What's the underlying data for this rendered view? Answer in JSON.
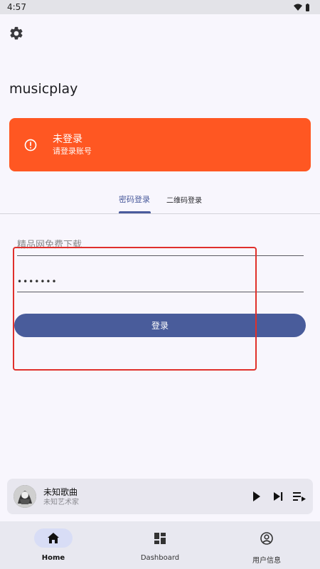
{
  "status_bar": {
    "time": "4:57",
    "icons": [
      "wifi-icon",
      "battery-icon"
    ]
  },
  "header": {
    "settings_icon": "gear-icon"
  },
  "app": {
    "title": "musicplay"
  },
  "banner": {
    "icon": "alert-circle-icon",
    "title": "未登录",
    "subtitle": "请登录账号",
    "color": "#ff5722"
  },
  "tabs": [
    {
      "label": "密码登录",
      "active": true
    },
    {
      "label": "二维码登录",
      "active": false
    }
  ],
  "form": {
    "username_placeholder": "精品网免费下载",
    "password_value": "•••••••",
    "login_label": "登录"
  },
  "player": {
    "title": "未知歌曲",
    "artist": "未知艺术家",
    "controls": [
      "play-icon",
      "skip-next-icon",
      "queue-icon"
    ]
  },
  "bottom_nav": [
    {
      "label": "Home",
      "icon": "home-icon",
      "active": true
    },
    {
      "label": "Dashboard",
      "icon": "dashboard-icon",
      "active": false
    },
    {
      "label": "用户信息",
      "icon": "account-circle-icon",
      "active": false
    }
  ],
  "colors": {
    "accent": "#4a5b9c",
    "button": "#495c9b",
    "highlight": "#e0302b"
  }
}
